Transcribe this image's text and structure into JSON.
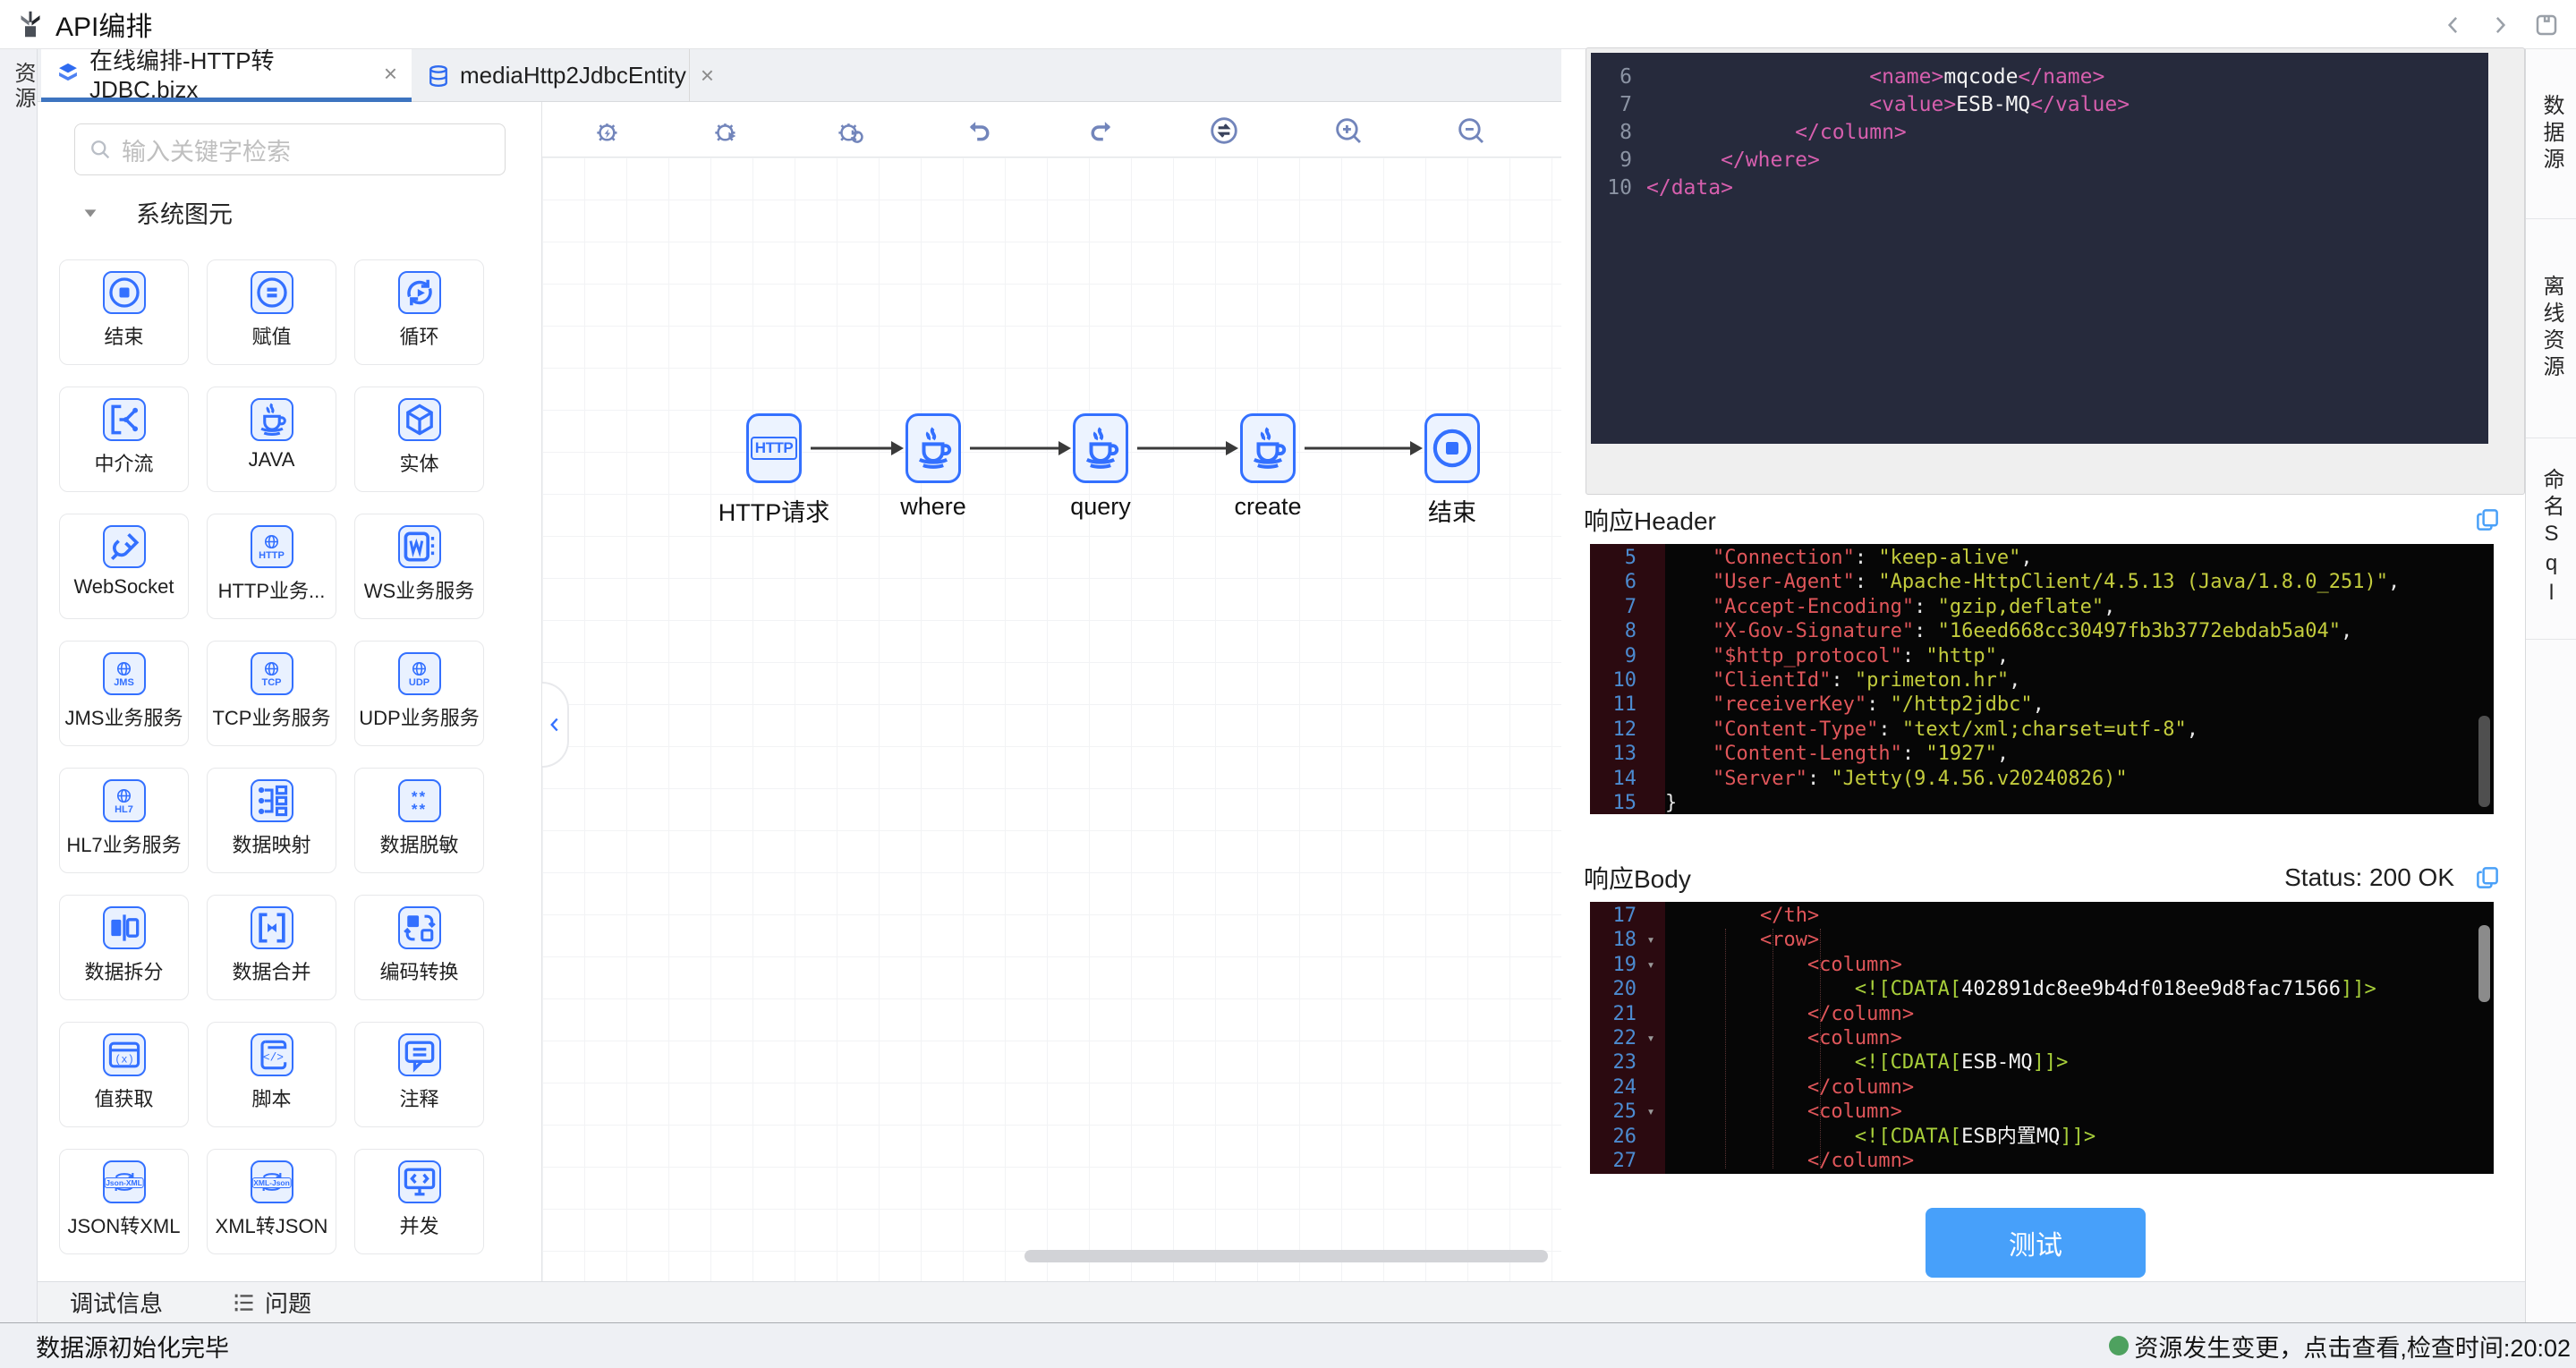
{
  "header": {
    "title": "API编排",
    "actions": [
      {
        "icon": "nav-back"
      },
      {
        "icon": "nav-forward"
      },
      {
        "icon": "save"
      }
    ]
  },
  "left_rail": {
    "label": "资源"
  },
  "tabs": [
    {
      "label": "在线编排-HTTP转JDBC.bizx",
      "icon": "layers",
      "close": "×",
      "active": true
    },
    {
      "label": "mediaHttp2JdbcEntity",
      "icon": "database",
      "close": "×",
      "active": false
    }
  ],
  "palette": {
    "search_placeholder": "输入关键字检索",
    "section_title": "系统图元",
    "tiles": [
      {
        "label": "结束",
        "icon": "end"
      },
      {
        "label": "赋值",
        "icon": "assign"
      },
      {
        "label": "循环",
        "icon": "loop"
      },
      {
        "label": "中介流",
        "icon": "mediator"
      },
      {
        "label": "JAVA",
        "icon": "java"
      },
      {
        "label": "实体",
        "icon": "entity"
      },
      {
        "label": "WebSocket",
        "icon": "websocket"
      },
      {
        "label": "HTTP业务...",
        "icon": "http-svc"
      },
      {
        "label": "WS业务服务",
        "icon": "ws-svc"
      },
      {
        "label": "JMS业务服务",
        "icon": "jms-svc"
      },
      {
        "label": "TCP业务服务",
        "icon": "tcp-svc"
      },
      {
        "label": "UDP业务服务",
        "icon": "udp-svc"
      },
      {
        "label": "HL7业务服务",
        "icon": "hl7-svc"
      },
      {
        "label": "数据映射",
        "icon": "data-map"
      },
      {
        "label": "数据脱敏",
        "icon": "data-mask"
      },
      {
        "label": "数据拆分",
        "icon": "data-split"
      },
      {
        "label": "数据合并",
        "icon": "data-merge"
      },
      {
        "label": "编码转换",
        "icon": "encode"
      },
      {
        "label": "值获取",
        "icon": "value-get"
      },
      {
        "label": "脚本",
        "icon": "script"
      },
      {
        "label": "注释",
        "icon": "comment"
      },
      {
        "label": "JSON转XML",
        "icon": "json2xml"
      },
      {
        "label": "XML转JSON",
        "icon": "xml2json"
      },
      {
        "label": "并发",
        "icon": "concurrent"
      }
    ]
  },
  "canvas": {
    "toolbar": [
      {
        "icon": "debug-run"
      },
      {
        "icon": "debug-start"
      },
      {
        "icon": "debug-restart"
      },
      {
        "icon": "undo"
      },
      {
        "icon": "redo"
      },
      {
        "icon": "switch"
      },
      {
        "icon": "zoom-in"
      },
      {
        "icon": "zoom-out"
      }
    ],
    "nodes": [
      {
        "label": "HTTP请求",
        "icon": "http-node"
      },
      {
        "label": "where",
        "icon": "java"
      },
      {
        "label": "query",
        "icon": "java"
      },
      {
        "label": "create",
        "icon": "java"
      },
      {
        "label": "结束",
        "icon": "end"
      }
    ]
  },
  "response_xml": {
    "lines": [
      {
        "n": 6,
        "ind": 18,
        "seg": [
          [
            "tag",
            "<name>"
          ],
          [
            "txt",
            "mqcode"
          ],
          [
            "tag",
            "</name>"
          ]
        ]
      },
      {
        "n": 7,
        "ind": 18,
        "seg": [
          [
            "tag",
            "<value>"
          ],
          [
            "txt",
            "ESB-MQ"
          ],
          [
            "tag",
            "</value>"
          ]
        ]
      },
      {
        "n": 8,
        "ind": 12,
        "seg": [
          [
            "tag",
            "</column>"
          ]
        ]
      },
      {
        "n": 9,
        "ind": 6,
        "seg": [
          [
            "tag",
            "</where>"
          ]
        ]
      },
      {
        "n": 10,
        "ind": 0,
        "seg": [
          [
            "tag",
            "</data>"
          ]
        ]
      }
    ]
  },
  "response_header": {
    "title": "响应Header",
    "lines": [
      {
        "n": 5,
        "ind": 4,
        "seg": [
          [
            "key",
            "\"Connection\""
          ],
          [
            "pun",
            ": "
          ],
          [
            "str",
            "\"keep-alive\""
          ],
          [
            "pun",
            ","
          ]
        ]
      },
      {
        "n": 6,
        "ind": 4,
        "seg": [
          [
            "key",
            "\"User-Agent\""
          ],
          [
            "pun",
            ": "
          ],
          [
            "str",
            "\"Apache-HttpClient/4.5.13 (Java/1.8.0_251)\""
          ],
          [
            "pun",
            ","
          ]
        ]
      },
      {
        "n": 7,
        "ind": 4,
        "seg": [
          [
            "key",
            "\"Accept-Encoding\""
          ],
          [
            "pun",
            ": "
          ],
          [
            "str",
            "\"gzip,deflate\""
          ],
          [
            "pun",
            ","
          ]
        ]
      },
      {
        "n": 8,
        "ind": 4,
        "seg": [
          [
            "key",
            "\"X-Gov-Signature\""
          ],
          [
            "pun",
            ": "
          ],
          [
            "str",
            "\"16eed668cc30497fb3b3772ebdab5a04\""
          ],
          [
            "pun",
            ","
          ]
        ]
      },
      {
        "n": 9,
        "ind": 4,
        "seg": [
          [
            "key",
            "\"$http_protocol\""
          ],
          [
            "pun",
            ": "
          ],
          [
            "str",
            "\"http\""
          ],
          [
            "pun",
            ","
          ]
        ]
      },
      {
        "n": 10,
        "ind": 4,
        "seg": [
          [
            "key",
            "\"ClientId\""
          ],
          [
            "pun",
            ": "
          ],
          [
            "str",
            "\"primeton.hr\""
          ],
          [
            "pun",
            ","
          ]
        ]
      },
      {
        "n": 11,
        "ind": 4,
        "seg": [
          [
            "key",
            "\"receiverKey\""
          ],
          [
            "pun",
            ": "
          ],
          [
            "str",
            "\"/http2jdbc\""
          ],
          [
            "pun",
            ","
          ]
        ]
      },
      {
        "n": 12,
        "ind": 4,
        "seg": [
          [
            "key",
            "\"Content-Type\""
          ],
          [
            "pun",
            ": "
          ],
          [
            "str",
            "\"text/xml;charset=utf-8\""
          ],
          [
            "pun",
            ","
          ]
        ]
      },
      {
        "n": 13,
        "ind": 4,
        "seg": [
          [
            "key",
            "\"Content-Length\""
          ],
          [
            "pun",
            ": "
          ],
          [
            "str",
            "\"1927\""
          ],
          [
            "pun",
            ","
          ]
        ]
      },
      {
        "n": 14,
        "ind": 4,
        "seg": [
          [
            "key",
            "\"Server\""
          ],
          [
            "pun",
            ": "
          ],
          [
            "str",
            "\"Jetty(9.4.56.v20240826)\""
          ]
        ]
      },
      {
        "n": 15,
        "ind": 0,
        "seg": [
          [
            "pun",
            "}"
          ]
        ]
      }
    ]
  },
  "response_body": {
    "title": "响应Body",
    "status": "Status: 200 OK",
    "lines": [
      {
        "n": 17,
        "ind": 8,
        "seg": [
          [
            "tag",
            "</th>"
          ]
        ]
      },
      {
        "n": 18,
        "ind": 8,
        "fold": true,
        "seg": [
          [
            "tag",
            "<row>"
          ]
        ]
      },
      {
        "n": 19,
        "ind": 12,
        "fold": true,
        "seg": [
          [
            "tag",
            "<column>"
          ]
        ]
      },
      {
        "n": 20,
        "ind": 16,
        "seg": [
          [
            "cd",
            "<![CDATA["
          ],
          [
            "txt",
            "402891dc8ee9b4df018ee9d8fac71566"
          ],
          [
            "cd",
            "]]>"
          ]
        ]
      },
      {
        "n": 21,
        "ind": 12,
        "seg": [
          [
            "tag",
            "</column>"
          ]
        ]
      },
      {
        "n": 22,
        "ind": 12,
        "fold": true,
        "seg": [
          [
            "tag",
            "<column>"
          ]
        ]
      },
      {
        "n": 23,
        "ind": 16,
        "seg": [
          [
            "cd",
            "<![CDATA["
          ],
          [
            "txt",
            "ESB-MQ"
          ],
          [
            "cd",
            "]]>"
          ]
        ]
      },
      {
        "n": 24,
        "ind": 12,
        "seg": [
          [
            "tag",
            "</column>"
          ]
        ]
      },
      {
        "n": 25,
        "ind": 12,
        "fold": true,
        "seg": [
          [
            "tag",
            "<column>"
          ]
        ]
      },
      {
        "n": 26,
        "ind": 16,
        "seg": [
          [
            "cd",
            "<![CDATA["
          ],
          [
            "txt",
            "ESB内置MQ"
          ],
          [
            "cd",
            "]]>"
          ]
        ]
      },
      {
        "n": 27,
        "ind": 12,
        "seg": [
          [
            "tag",
            "</column>"
          ]
        ]
      }
    ]
  },
  "test_button_label": "测试",
  "right_rail": {
    "tabs": [
      "数据源",
      "离线资源",
      "命名Sql"
    ]
  },
  "bottom": {
    "debug_tab": "调试信息",
    "issues_tab": "问题",
    "status_left": "数据源初始化完毕",
    "status_right": "资源发生变更，点击查看,检查时间:20:02"
  },
  "colors": {
    "accent_blue": "#3370ff",
    "tab_underline": "#3d74c0",
    "button_blue": "#47a0fa",
    "status_green": "#4ea15f",
    "code_tag_pink": "#d75fae",
    "code_tag_red": "#e0565a",
    "code_string_yellow": "#c3cc3d",
    "code_cdata_green": "#a8cf3a"
  }
}
